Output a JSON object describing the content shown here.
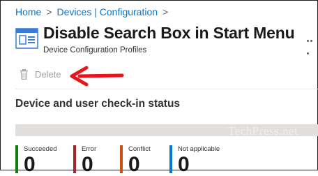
{
  "breadcrumb": {
    "home": "Home",
    "separator": ">",
    "devices_config": "Devices | Configuration"
  },
  "page": {
    "title": "Disable Search Box in Start Menu",
    "subtitle": "Device Configuration Profiles",
    "icon": "configuration-profile-icon"
  },
  "toolbar": {
    "delete_label": "Delete",
    "delete_icon": "trash-icon"
  },
  "annotation": {
    "arrow_color": "#e8141c"
  },
  "section": {
    "title": "Device and user check-in status"
  },
  "watermark": "TechPress.net",
  "status_tiles": [
    {
      "label": "Succeeded",
      "value": "0",
      "color": "#107c10"
    },
    {
      "label": "Error",
      "value": "0",
      "color": "#a4262c"
    },
    {
      "label": "Conflict",
      "value": "0",
      "color": "#ca5010"
    },
    {
      "label": "Not applicable",
      "value": "0",
      "color": "#0078d4"
    }
  ]
}
